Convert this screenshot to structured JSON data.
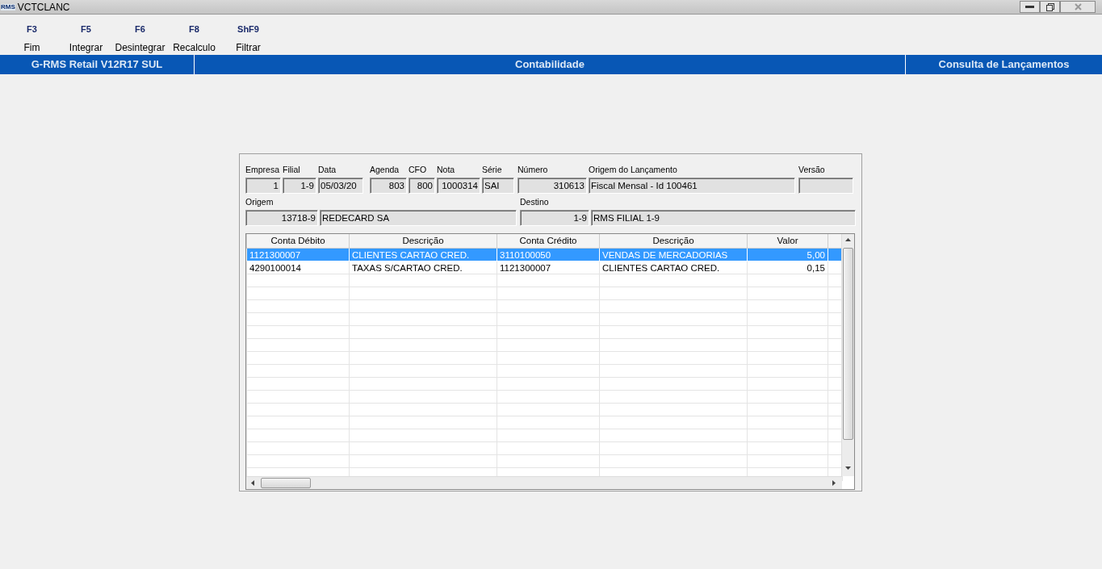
{
  "window": {
    "title": "VCTCLANC",
    "app_icon_text": "RMS"
  },
  "toolbar": [
    {
      "key": "F3",
      "label": "Fim"
    },
    {
      "key": "F5",
      "label": "Integrar"
    },
    {
      "key": "F6",
      "label": "Desintegrar"
    },
    {
      "key": "F8",
      "label": "Recalculo"
    },
    {
      "key": "ShF9",
      "label": "Filtrar"
    }
  ],
  "header_bar": {
    "system": "G-RMS Retail V12R17 SUL",
    "module": "Contabilidade",
    "screen": "Consulta de Lançamentos"
  },
  "form": {
    "row_1": [
      {
        "label": "Empresa",
        "value": "1"
      },
      {
        "label": "Filial",
        "value": "1-9"
      },
      {
        "label": "Data",
        "value": "05/03/20"
      },
      {
        "label": "Agenda",
        "value": "803"
      },
      {
        "label": "CFO",
        "value": "800"
      },
      {
        "label": "Nota",
        "value": "1000314"
      },
      {
        "label": "Série",
        "value": "SAI"
      },
      {
        "label": "Número",
        "value": "310613"
      },
      {
        "label": "Origem do Lançamento",
        "value": "Fiscal Mensal - Id 100461"
      },
      {
        "label": "Versão"
      }
    ],
    "row_2": [
      {
        "label": "Origem",
        "value": "13718-9"
      },
      {
        "value": "REDECARD SA"
      },
      {
        "label": "Destino",
        "value": "1-9"
      },
      {
        "value": "RMS FILIAL 1-9"
      }
    ]
  },
  "table": {
    "columns": [
      {
        "label": "Conta Débito"
      },
      {
        "label": "Descrição"
      },
      {
        "label": "Conta Crédito"
      },
      {
        "label": "Descrição"
      },
      {
        "label": "Valor"
      },
      {}
    ],
    "rows": [
      {
        "selected": true,
        "cells": [
          "1121300007",
          "CLIENTES CARTAO CRED.",
          "3110100050",
          "VENDAS DE MERCADORIAS",
          "5,00",
          ""
        ]
      },
      {
        "selected": false,
        "cells": [
          "4290100014",
          "TAXAS S/CARTAO CRED.",
          "1121300007",
          "CLIENTES CARTAO CRED.",
          "0,15",
          ""
        ]
      }
    ]
  }
}
